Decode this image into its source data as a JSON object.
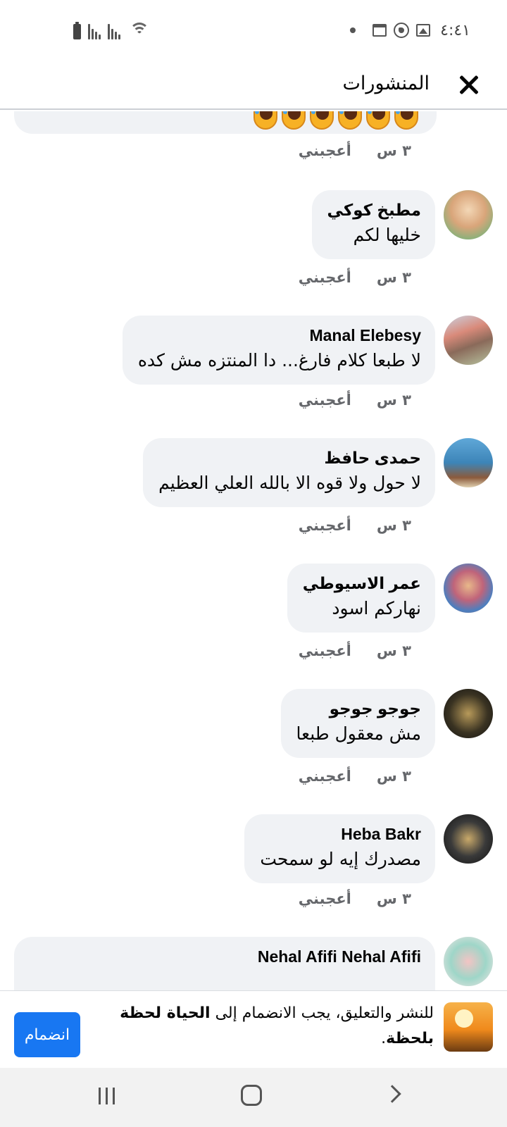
{
  "status_bar": {
    "time": "٤:٤١",
    "icons": [
      "battery-icon",
      "signal-icon",
      "signal-icon",
      "wifi-icon",
      "dot-icon",
      "calendar-icon",
      "whatsapp-icon",
      "gallery-icon"
    ]
  },
  "header": {
    "title": "المنشورات",
    "close_icon": "close-icon"
  },
  "top_comment": {
    "time": "٣ س",
    "like": "أعجبني",
    "emoji": "laughing-emoji"
  },
  "comments": [
    {
      "name": "مطبخ كوكي",
      "text": "خليها لكم",
      "time": "٣ س",
      "like": "أعجبني"
    },
    {
      "name": "Manal Elebesy",
      "text": "لا طبعا كلام فارغ... دا المنتزه مش كده",
      "time": "٣ س",
      "like": "أعجبني"
    },
    {
      "name": "حمدى حافظ",
      "text": "لا حول ولا قوه الا بالله العلي العظيم",
      "time": "٣ س",
      "like": "أعجبني"
    },
    {
      "name": "عمر الاسيوطي",
      "text": "نهاركم  اسود",
      "time": "٣ س",
      "like": "أعجبني"
    },
    {
      "name": "جوجو جوجو",
      "text": "مش معقول طبعا",
      "time": "٣ س",
      "like": "أعجبني"
    },
    {
      "name": "Heba Bakr",
      "text": "مصدرك إيه لو سمحت",
      "time": "٣ س",
      "like": "أعجبني"
    },
    {
      "name": "Nehal Afifi Nehal Afifi",
      "text": "",
      "time": "",
      "like": ""
    }
  ],
  "join_bar": {
    "text_part1": "للنشر والتعليق، يجب الانضمام إلى ",
    "group_name": "الحياة لحظة بلحظة",
    "text_part2": ".",
    "button_label": "انضمام"
  },
  "colors": {
    "accent": "#1877f2",
    "bubble": "#f0f2f5",
    "meta_text": "#65676b"
  }
}
